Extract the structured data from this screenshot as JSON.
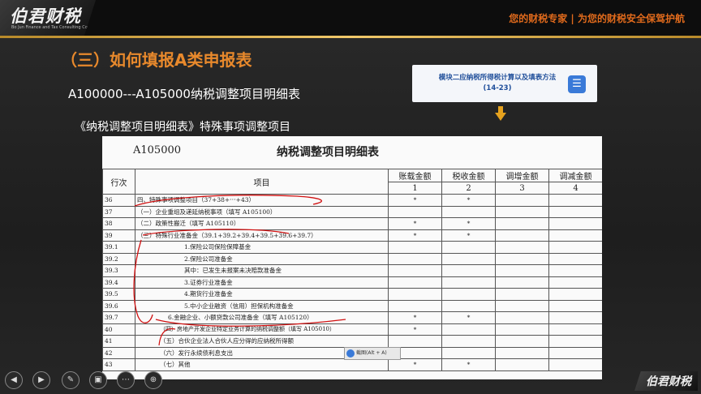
{
  "header": {
    "logo": "伯君财税",
    "logo_sub": "Bo Jun Finance and Tax Consulting Co., Ltd",
    "slogan": "您的财税专家 | 为您的财税安全保驾护航"
  },
  "slide": {
    "title": "（三）如何填报A类申报表",
    "subtitle1": "A100000---A105000纳税调整项目明细表",
    "subtitle2": "《纳税调整项目明细表》特殊事项调整项目"
  },
  "module_button": {
    "line1": "模块二应纳税所得税计算以及填表方法",
    "line2": "(14-23)",
    "icon": "menu-icon"
  },
  "document": {
    "code": "A105000",
    "title": "纳税调整项目明细表",
    "headers": {
      "row_no": "行次",
      "item": "项目",
      "col1": "账载金额",
      "col2": "税收金额",
      "col3": "调增金额",
      "col4": "调减金额",
      "n1": "1",
      "n2": "2",
      "n3": "3",
      "n4": "4"
    },
    "rows": [
      {
        "no": "36",
        "item": "四、特殊事项调整项目（37+38+⋯+43）",
        "c1": "*",
        "c2": "*"
      },
      {
        "no": "37",
        "item": "（一）企业重组及递延纳税事项（填写 A105100）",
        "c1": "",
        "c2": ""
      },
      {
        "no": "38",
        "item": "（二）政策性搬迁（填写 A105110）",
        "c1": "*",
        "c2": "*"
      },
      {
        "no": "39",
        "item": "（三）特殊行业准备金（39.1+39.2+39.4+39.5+39.6+39.7）",
        "c1": "*",
        "c2": "*"
      },
      {
        "no": "39.1",
        "item": "1.保险公司保险保障基金",
        "c1": "",
        "c2": ""
      },
      {
        "no": "39.2",
        "item": "2.保险公司准备金",
        "c1": "",
        "c2": ""
      },
      {
        "no": "39.3",
        "item": "其中：已发生未报案未决赔款准备金",
        "c1": "",
        "c2": ""
      },
      {
        "no": "39.4",
        "item": "3.证券行业准备金",
        "c1": "",
        "c2": ""
      },
      {
        "no": "39.5",
        "item": "4.期货行业准备金",
        "c1": "",
        "c2": ""
      },
      {
        "no": "39.6",
        "item": "5.中小企业融资（信用）担保机构准备金",
        "c1": "",
        "c2": ""
      },
      {
        "no": "39.7",
        "item": "6.金融企业、小额贷款公司准备金（填写 A105120）",
        "c1": "*",
        "c2": "*"
      },
      {
        "no": "40",
        "item": "（四）房地产开发企业特定业务计算的纳税调整额（填写 A105010）",
        "c1": "*",
        "c2": ""
      },
      {
        "no": "41",
        "item": "（五）合伙企业法人合伙人应分得的应纳税所得额",
        "c1": "",
        "c2": ""
      },
      {
        "no": "42",
        "item": "（六）发行永续债利息支出",
        "c1": "",
        "c2": ""
      },
      {
        "no": "43",
        "item": "（七）其他",
        "c1": "*",
        "c2": "*"
      }
    ]
  },
  "tooltip": {
    "text": "截图(Alt + A)"
  },
  "toolbar": {
    "buttons": [
      "prev-icon",
      "next-icon",
      "pen-icon",
      "screen-icon",
      "more-icon",
      "zoom-icon"
    ]
  },
  "footer_logo": "伯君财税",
  "colors": {
    "title": "#e8892c",
    "slogan": "#e06a1c",
    "annotation": "#d01010",
    "module_text": "#1f4e9a"
  }
}
